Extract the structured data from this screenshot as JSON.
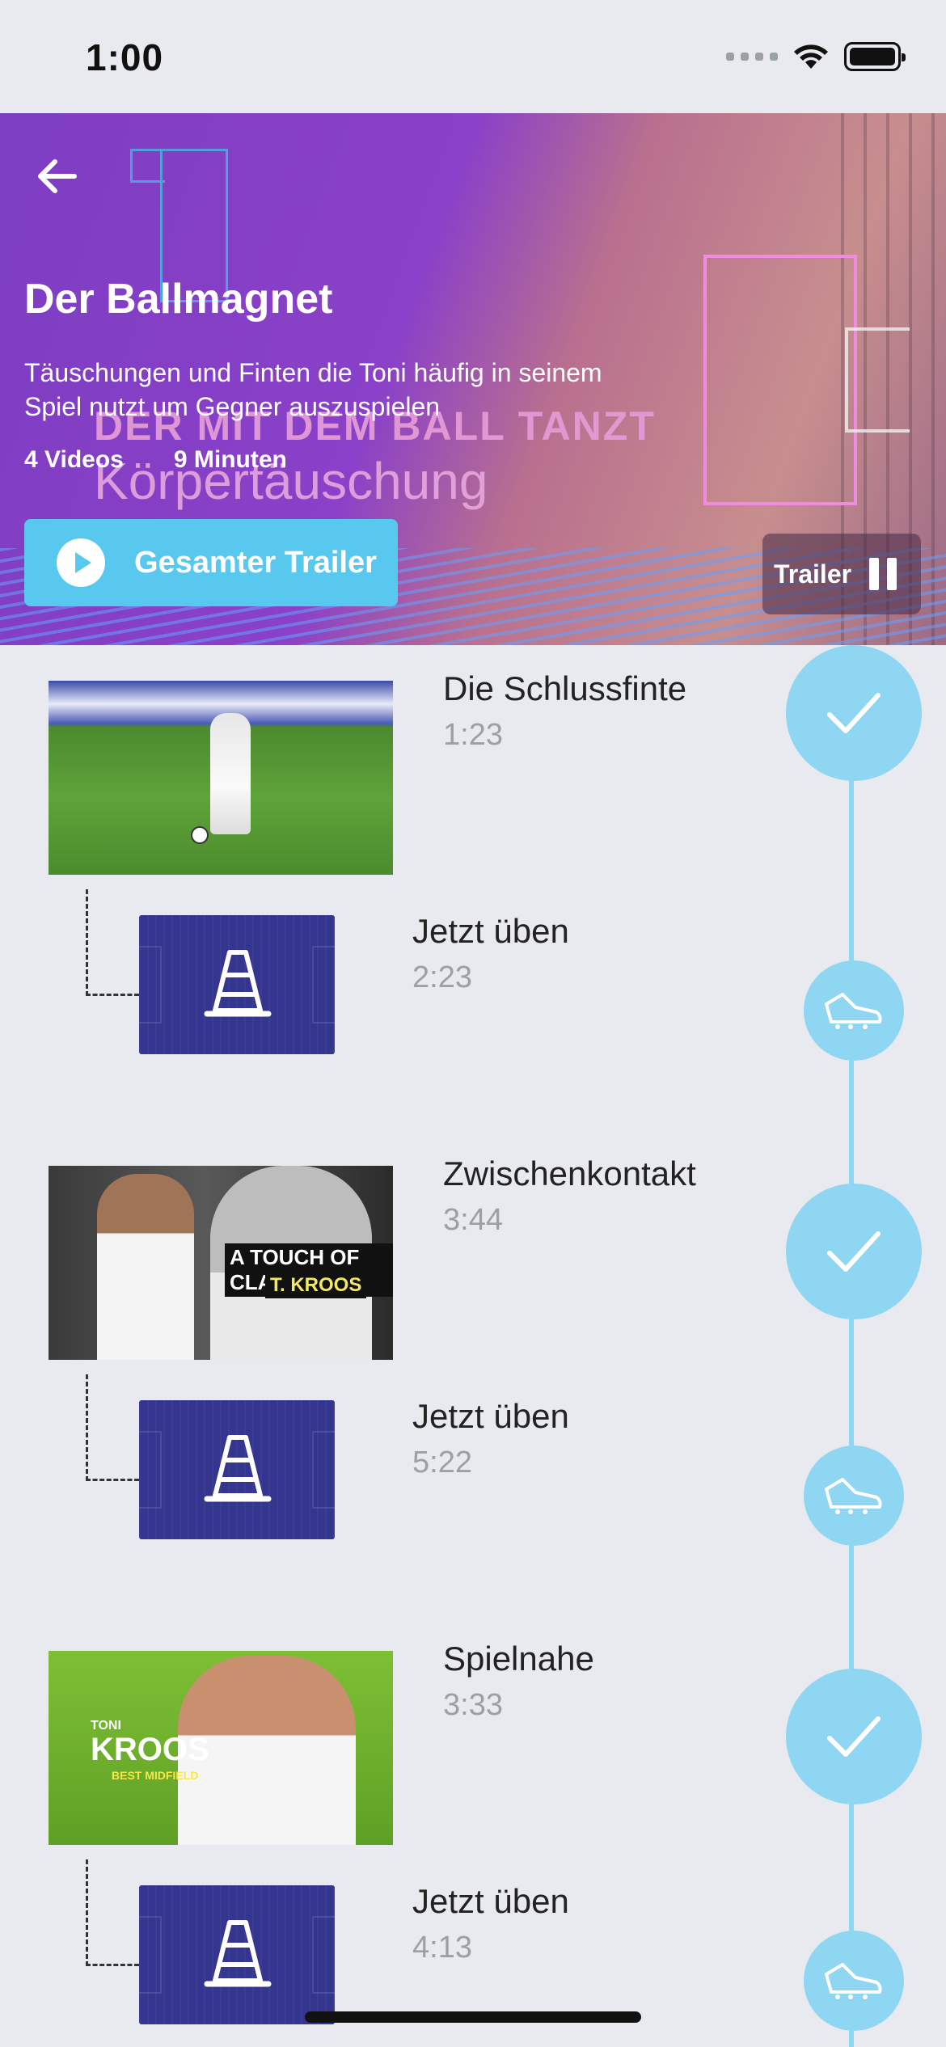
{
  "status_bar": {
    "time": "1:00"
  },
  "hero": {
    "title": "Der Ballmagnet",
    "description": "Täuschungen und Finten die Toni häufig in seinem Spiel nutzt um Gegner auszuspielen",
    "videos_count": "4 Videos",
    "duration": "9 Minuten",
    "trailer_button": "Gesamter Trailer",
    "mini_trailer_label": "Trailer",
    "overlay_title": "DER MIT DEM BALL TANZT",
    "overlay_subtitle": "Körpertäuschung"
  },
  "lessons": [
    {
      "title": "Die Schlussfinte",
      "duration": "1:23",
      "practice": {
        "title": "Jetzt üben",
        "duration": "2:23"
      }
    },
    {
      "title": "Zwischenkontakt",
      "duration": "3:44",
      "thumb_caption_1": "A TOUCH OF CLASS",
      "thumb_caption_2": "T. KROOS",
      "practice": {
        "title": "Jetzt üben",
        "duration": "5:22"
      }
    },
    {
      "title": "Spielnahe",
      "duration": "3:33",
      "thumb_text_1": "TONI",
      "thumb_text_2": "KROOS",
      "thumb_text_3": "BEST MIDFIELD",
      "practice": {
        "title": "Jetzt üben",
        "duration": "4:13"
      }
    }
  ],
  "colors": {
    "accent": "#59c8ee",
    "timeline": "#8fd6f3",
    "drill_bg": "#33358f",
    "hero_purple": "#8a40c8"
  }
}
